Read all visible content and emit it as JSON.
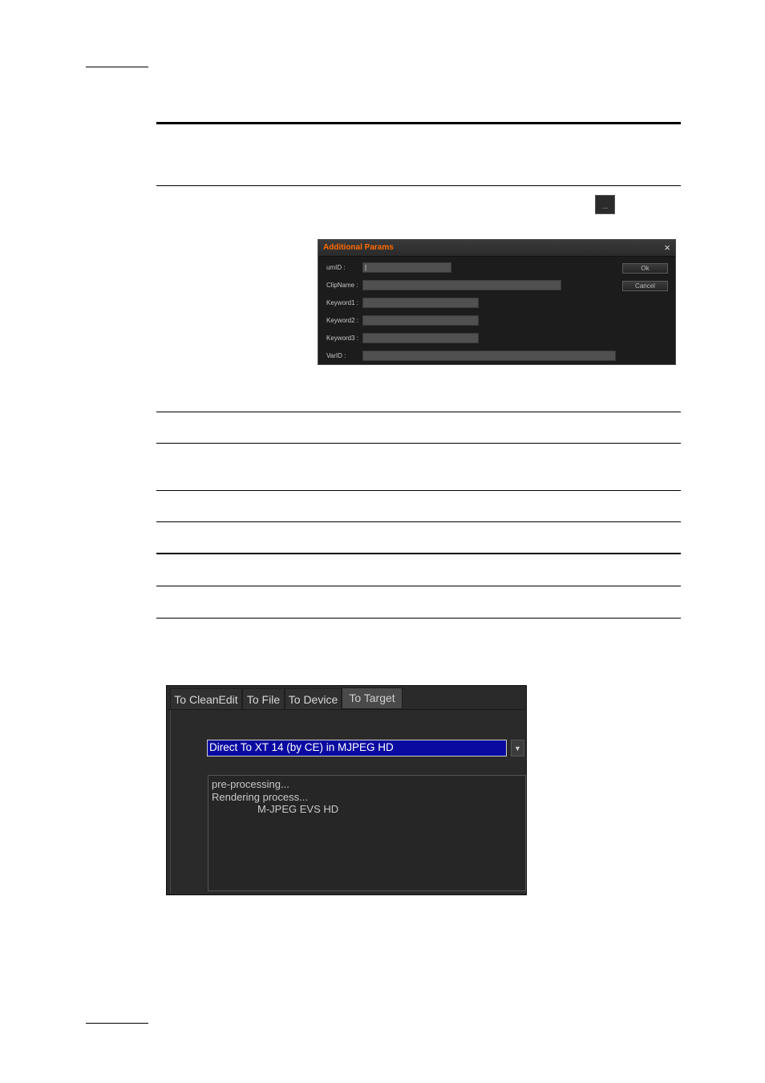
{
  "dialog": {
    "title": "Additional Params",
    "close_glyph": "×",
    "fields": [
      {
        "label": "umID :",
        "value": "|"
      },
      {
        "label": "ClipName :",
        "value": ""
      },
      {
        "label": "Keyword1 :",
        "value": ""
      },
      {
        "label": "Keyword2 :",
        "value": ""
      },
      {
        "label": "Keyword3 :",
        "value": ""
      },
      {
        "label": "VarID :",
        "value": ""
      }
    ],
    "ok_label": "Ok",
    "cancel_label": "Cancel",
    "accent_color": "#ff6a00"
  },
  "ellipsis_button": {
    "label": "..."
  },
  "target_panel": {
    "tabs": [
      {
        "label": "To CleanEdit"
      },
      {
        "label": "To File"
      },
      {
        "label": "To Device"
      },
      {
        "label": "To Target",
        "active": true
      }
    ],
    "target_select": {
      "value": "Direct To XT 14 (by CE) in MJPEG HD"
    },
    "log_lines": [
      "pre-processing...",
      "Rendering process...",
      "M-JPEG EVS HD"
    ],
    "selection_color": "#0a0aa0"
  }
}
